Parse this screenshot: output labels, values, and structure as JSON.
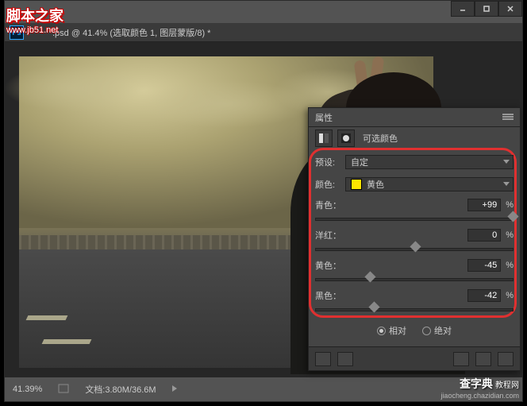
{
  "titlebar": {
    "tab_text": ".psd @ 41.4% (选取颜色 1, 图层蒙版/8) *"
  },
  "watermark_tl": {
    "text": "脚本之家",
    "url": "www.jb51.net"
  },
  "watermark_br": {
    "main": "查字典",
    "sub": "教程网",
    "url": "jiaocheng.chazidian.com"
  },
  "statusbar": {
    "zoom": "41.39%",
    "doc_label": "文档:",
    "doc_value": "3.80M/36.6M"
  },
  "panel": {
    "title": "属性",
    "adj_name": "可选颜色",
    "preset_label": "预设:",
    "preset_value": "自定",
    "color_label": "颜色:",
    "color_value": "黄色",
    "sliders": [
      {
        "label": "青色：",
        "value": "+99",
        "pos": 99
      },
      {
        "label": "洋红：",
        "value": "0",
        "pos": 50
      },
      {
        "label": "黄色：",
        "value": "-45",
        "pos": 27
      },
      {
        "label": "黑色：",
        "value": "-42",
        "pos": 29
      }
    ],
    "pct": "%",
    "radio1": "相对",
    "radio2": "绝对"
  }
}
